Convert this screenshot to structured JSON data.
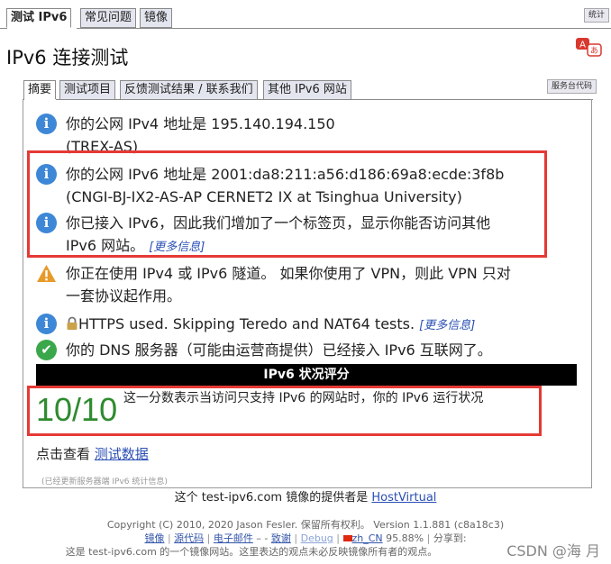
{
  "top_tabs": [
    {
      "label": "测试 IPv6",
      "active": true
    },
    {
      "label": "常见问题",
      "active": false
    },
    {
      "label": "镜像",
      "active": false
    }
  ],
  "stats_button": "统计",
  "page_title": "IPv6 连接测试",
  "translate_icon": "translate-icon",
  "sub_tabs": [
    {
      "label": "摘要",
      "active": true
    },
    {
      "label": "测试项目",
      "active": false
    },
    {
      "label": "反馈测试结果 / 联系我们",
      "active": false
    },
    {
      "label": "其他 IPv6 网站",
      "active": false
    }
  ],
  "service_code_button": "服务台代码",
  "results": {
    "ipv4": {
      "icon": "info-icon",
      "line1": "你的公网 IPv4 地址是 195.140.194.150",
      "line2": "(TREX-AS)"
    },
    "ipv6": {
      "icon": "info-icon",
      "line1": "你的公网 IPv6 地址是 2001:da8:211:a56:d186:69a8:ecde:3f8b",
      "line2": "(CNGI-BJ-IX2-AS-AP CERNET2 IX at Tsinghua University)"
    },
    "ipv6_tab": {
      "icon": "info-icon",
      "line1": "你已接入 IPv6，因此我们增加了一个标签页，显示你能否访问其他",
      "line2": "IPv6 网站。",
      "more": "[更多信息]"
    },
    "tunnel": {
      "icon": "warning-icon",
      "line1": "你正在使用 IPv4 或 IPv6 隧道。 如果你使用了 VPN，则此 VPN 只对",
      "line2": "一套协议起作用。"
    },
    "https": {
      "icon": "info-icon",
      "lock_icon": "lock-icon",
      "text": "HTTPS used. Skipping Teredo and NAT64 tests.",
      "more": "[更多信息]"
    },
    "dns": {
      "icon": "check-icon",
      "text": "你的 DNS 服务器（可能由运营商提供）已经接入 IPv6 互联网了。"
    }
  },
  "score": {
    "heading": "IPv6 状况评分",
    "value": "10/10",
    "description": "这一分数表示当访问只支持 IPv6 的网站时，你的 IPv6 运行状况"
  },
  "test_data": {
    "prefix": "点击查看 ",
    "link": "测试数据"
  },
  "stats_updated": "(已经更新服务器端 IPv6 统计信息)",
  "mirror": {
    "prefix": "这个 test-ipv6.com 镜像的提供者是 ",
    "provider": "HostVirtual"
  },
  "footer": {
    "copyright": "Copyright (C) 2010, 2020 Jason Fesler. 保留所有权利。 Version 1.1.881 (c8a18c3)",
    "links": [
      {
        "label": "镜像"
      },
      {
        "label": "源代码"
      },
      {
        "label": "电子邮件"
      },
      {
        "label": "-"
      },
      {
        "label": "致谢"
      },
      {
        "label": "Debug"
      }
    ],
    "locale_flag_icon": "flag-icon",
    "locale": "zh_CN",
    "locale_percent": "95.88%",
    "share": "分享到:",
    "disclaimer": "这是 test-ipv6.com 的一个镜像网站。这里表达的观点未必反映镜像所有者的观点。"
  },
  "watermark": "CSDN @海 月",
  "colors": {
    "accent_red": "#e53935",
    "score_green": "#2e8b2e",
    "info_blue": "#3d87d6",
    "ok_green": "#3aa84a",
    "warning_orange": "#e79a2a"
  }
}
